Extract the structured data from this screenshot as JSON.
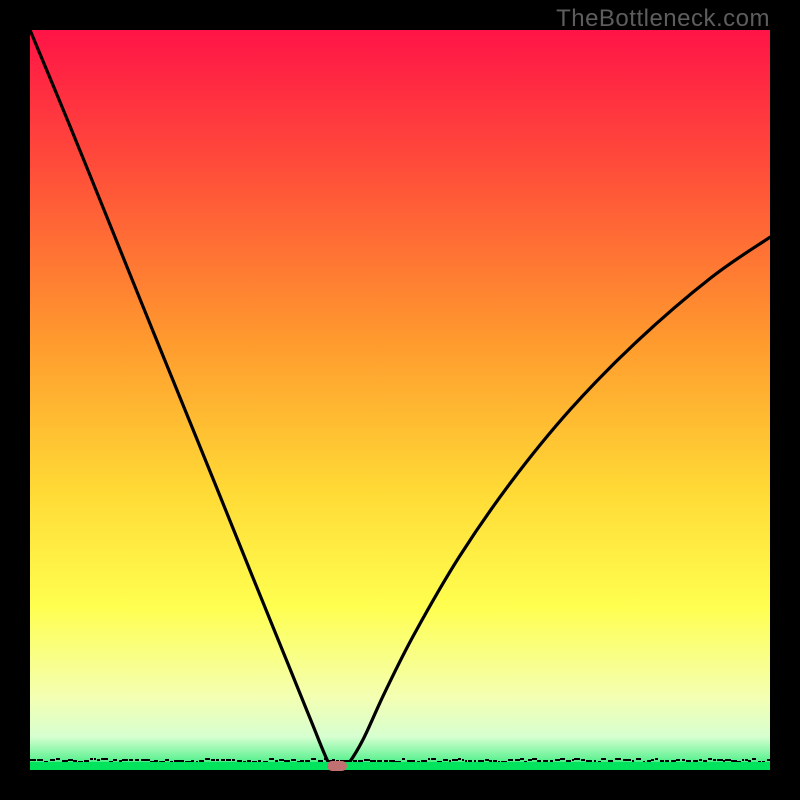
{
  "watermark": "TheBottleneck.com",
  "chart_data": {
    "type": "line",
    "title": "",
    "xlabel": "",
    "ylabel": "",
    "xlim": [
      0,
      100
    ],
    "ylim": [
      0,
      100
    ],
    "grid": false,
    "series": [
      {
        "name": "curve",
        "x": [
          0,
          5,
          10,
          15,
          20,
          25,
          30,
          35,
          38,
          40,
          41,
          42,
          43,
          45,
          48,
          52,
          58,
          65,
          73,
          82,
          92,
          100
        ],
        "values": [
          100,
          88,
          75.7,
          63.3,
          51,
          38.7,
          26.3,
          14,
          6.6,
          1.7,
          0,
          0,
          0.8,
          4.1,
          10.6,
          18.5,
          28.8,
          38.9,
          48.7,
          57.9,
          66.5,
          72
        ]
      }
    ],
    "marker": {
      "x": 41.5,
      "y": 0
    },
    "baseline_color": "#00e35c",
    "gradient_stops": [
      {
        "offset": 0.0,
        "color": "#ff1447"
      },
      {
        "offset": 0.18,
        "color": "#ff4b3a"
      },
      {
        "offset": 0.42,
        "color": "#ff9a2e"
      },
      {
        "offset": 0.62,
        "color": "#ffd935"
      },
      {
        "offset": 0.78,
        "color": "#ffff50"
      },
      {
        "offset": 0.9,
        "color": "#f4ffb1"
      },
      {
        "offset": 0.955,
        "color": "#d7ffd0"
      },
      {
        "offset": 0.985,
        "color": "#66f296"
      },
      {
        "offset": 1.0,
        "color": "#00e35c"
      }
    ]
  },
  "dims": {
    "outer": 800,
    "inner": 740,
    "margin": 30
  }
}
